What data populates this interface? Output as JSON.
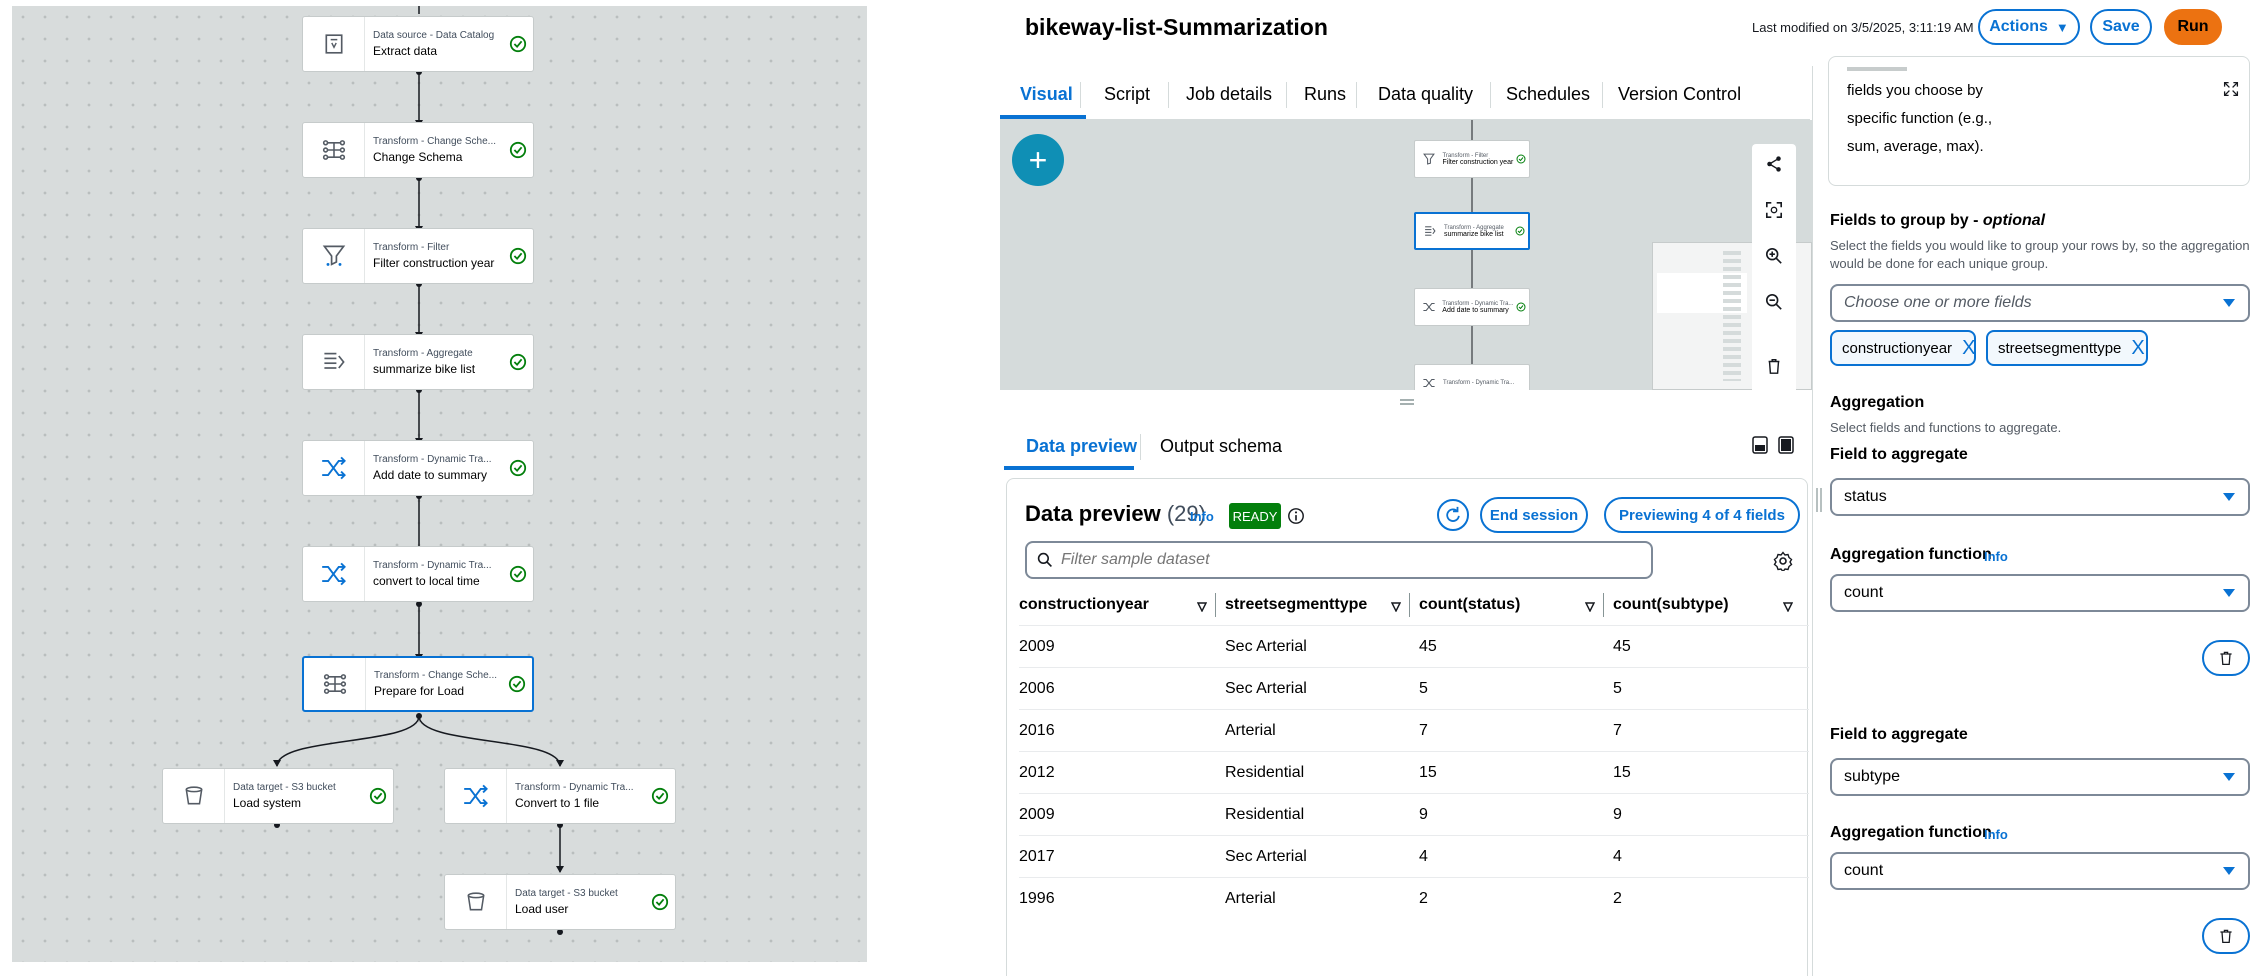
{
  "left_graph": {
    "nodes": [
      {
        "subtitle": "Data source - Data Catalog",
        "title": "Extract data",
        "icon": "catalog-icon"
      },
      {
        "subtitle": "Transform - Change Sche...",
        "title": "Change Schema",
        "icon": "schema-icon"
      },
      {
        "subtitle": "Transform - Filter",
        "title": "Filter construction year",
        "icon": "filter-icon"
      },
      {
        "subtitle": "Transform - Aggregate",
        "title": "summarize bike list",
        "icon": "aggregate-icon"
      },
      {
        "subtitle": "Transform - Dynamic Tra...",
        "title": "Add date to summary",
        "icon": "shuffle-icon"
      },
      {
        "subtitle": "Transform - Dynamic Tra...",
        "title": "convert to local time",
        "icon": "shuffle-icon"
      },
      {
        "subtitle": "Transform - Change Sche...",
        "title": "Prepare for Load",
        "icon": "schema-icon"
      },
      {
        "subtitle": "Data target - S3 bucket",
        "title": "Load system",
        "icon": "bucket-icon"
      },
      {
        "subtitle": "Transform - Dynamic Tra...",
        "title": "Convert to 1 file",
        "icon": "shuffle-icon"
      },
      {
        "subtitle": "Data target - S3 bucket",
        "title": "Load user",
        "icon": "bucket-icon"
      }
    ]
  },
  "header": {
    "job_title": "bikeway-list-Summarization",
    "last_modified": "Last modified on 3/5/2025, 3:11:19 AM",
    "actions_label": "Actions",
    "save_label": "Save",
    "run_label": "Run"
  },
  "tabs": [
    "Visual",
    "Script",
    "Job details",
    "Runs",
    "Data quality",
    "Schedules",
    "Version Control"
  ],
  "mini_graph": {
    "nodes": [
      {
        "subtitle": "Transform - Filter",
        "title": "Filter construction year"
      },
      {
        "subtitle": "Transform - Aggregate",
        "title": "summarize bike list"
      },
      {
        "subtitle": "Transform - Dynamic Tra...",
        "title": "Add date to summary"
      },
      {
        "subtitle": "Transform - Dynamic Tra...",
        "title": ""
      }
    ]
  },
  "data_preview": {
    "tabs": [
      "Data preview",
      "Output schema"
    ],
    "title": "Data preview",
    "count": "(29)",
    "info": "Info",
    "status": "READY",
    "end_session_label": "End session",
    "previewing_label": "Previewing 4 of 4 fields",
    "filter_placeholder": "Filter sample dataset",
    "columns": [
      "constructionyear",
      "streetsegmenttype",
      "count(status)",
      "count(subtype)"
    ],
    "rows": [
      [
        "2009",
        "Sec Arterial",
        "45",
        "45"
      ],
      [
        "2006",
        "Sec Arterial",
        "5",
        "5"
      ],
      [
        "2016",
        "Arterial",
        "7",
        "7"
      ],
      [
        "2012",
        "Residential",
        "15",
        "15"
      ],
      [
        "2009",
        "Residential",
        "9",
        "9"
      ],
      [
        "2017",
        "Sec Arterial",
        "4",
        "4"
      ],
      [
        "1996",
        "Arterial",
        "2",
        "2"
      ]
    ]
  },
  "aggregate_panel": {
    "desc_lines": [
      "fields you choose by",
      "specific function (e.g.,",
      "sum, average, max)."
    ],
    "group_by_label": "Fields to group by - ",
    "group_by_optional": "optional",
    "group_by_desc_1": "Select the fields you would like to group your rows by, so the aggregation",
    "group_by_desc_2": "would be done for each unique group.",
    "group_by_placeholder": "Choose one or more fields",
    "tokens": [
      "constructionyear",
      "streetsegmenttype"
    ],
    "aggregation_label": "Aggregation",
    "aggregation_desc": "Select fields and functions to aggregate.",
    "aggregations": [
      {
        "field_label": "Field to aggregate",
        "field_value": "status",
        "func_label": "Aggregation function",
        "info": "Info",
        "func_value": "count"
      },
      {
        "field_label": "Field to aggregate",
        "field_value": "subtype",
        "func_label": "Aggregation function",
        "info": "Info",
        "func_value": "count"
      }
    ]
  },
  "colors": {
    "accent": "#0972d3",
    "run": "#ec7211",
    "ready": "#037f0c",
    "success": "#037f0c"
  }
}
